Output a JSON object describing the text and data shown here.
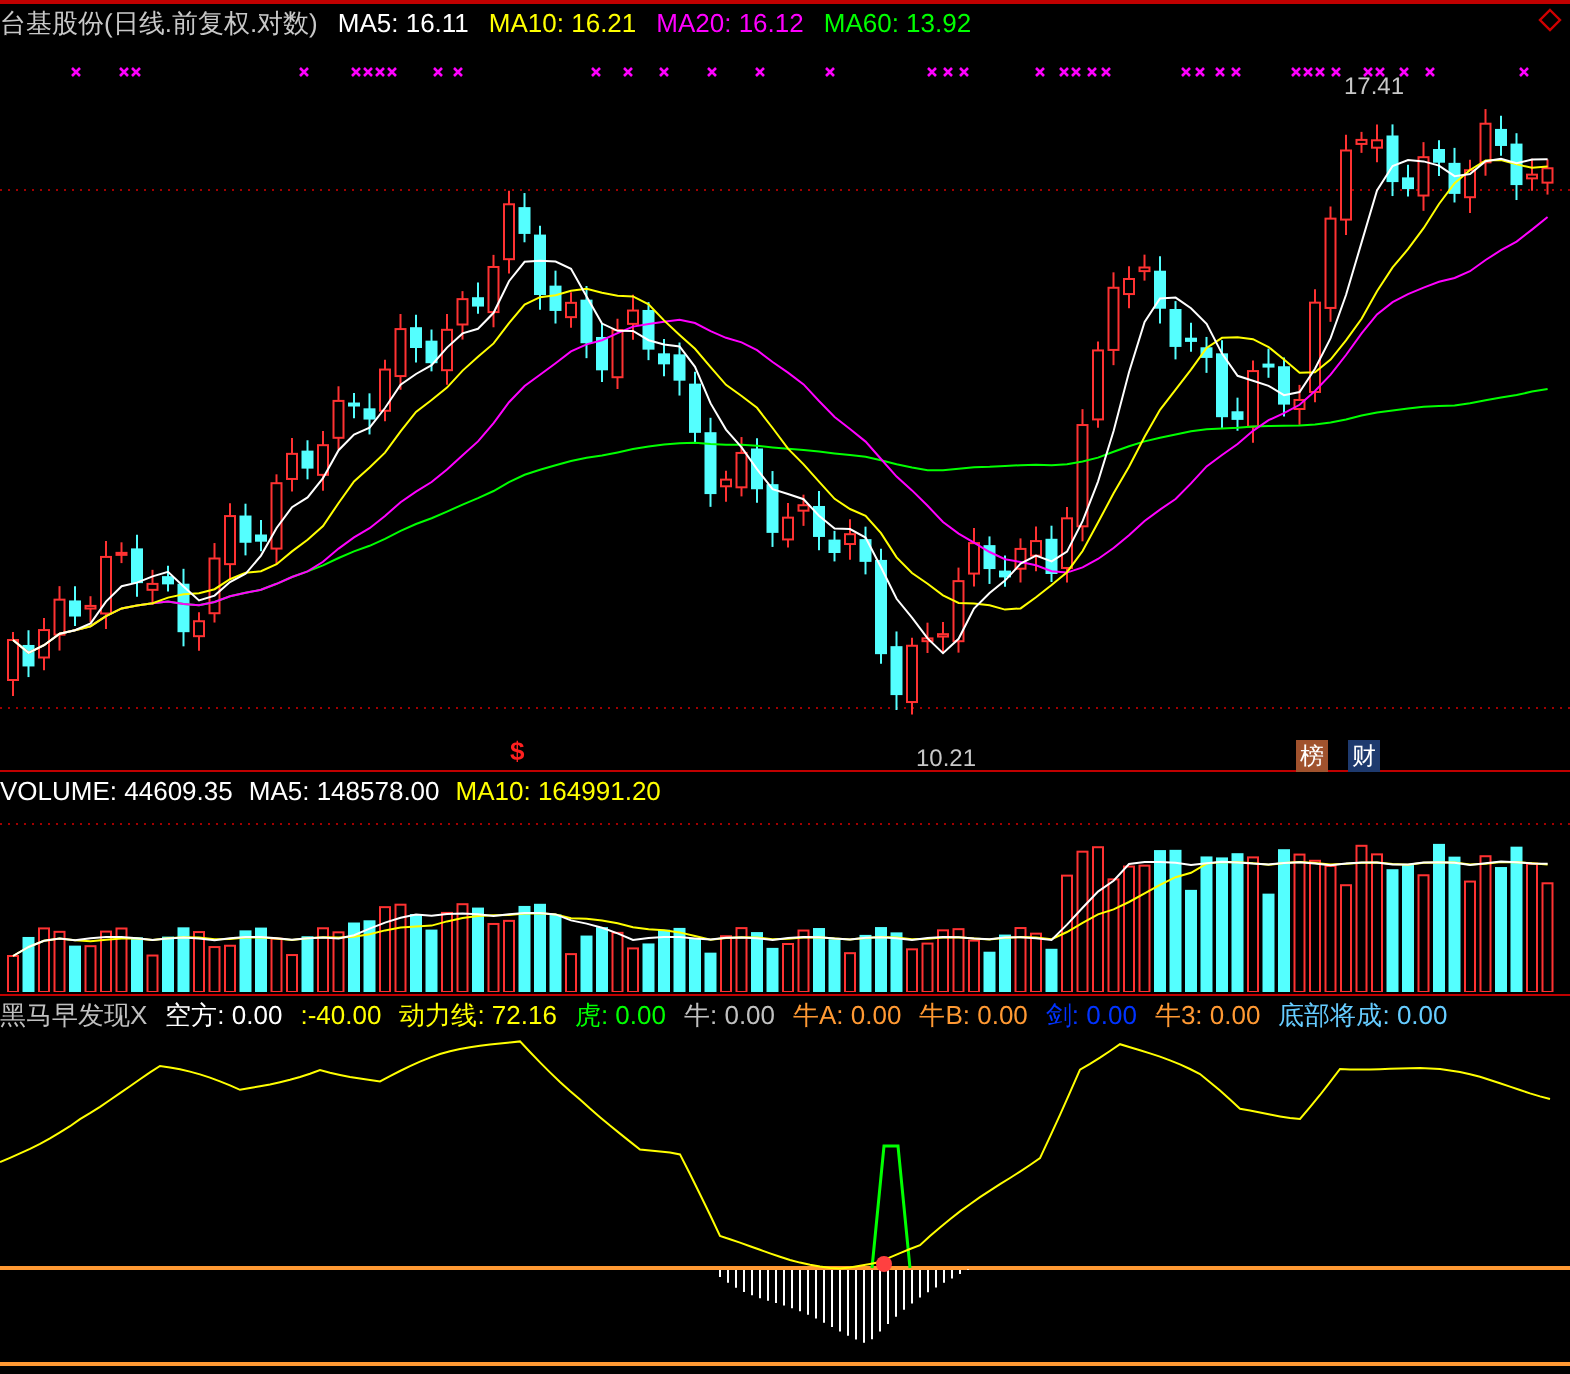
{
  "title": {
    "text": "台基股份(日线.前复权.对数)"
  },
  "main_legend": [
    {
      "label": "MA5: 16.11",
      "color": "#ffffff"
    },
    {
      "label": "MA10: 16.21",
      "color": "#ffff00"
    },
    {
      "label": "MA20: 16.12",
      "color": "#ff00ff"
    },
    {
      "label": "MA60: 13.92",
      "color": "#00ff00"
    }
  ],
  "price_labels": {
    "high": "17.41",
    "low": "10.21"
  },
  "marker": "$",
  "badges": [
    {
      "text": "榜",
      "color": "#a0522d"
    },
    {
      "text": "财",
      "color": "#1e3a6e"
    }
  ],
  "volume_legend": [
    {
      "label": "VOLUME: 44609.35",
      "color": "#ffffff"
    },
    {
      "label": "MA5: 148578.00",
      "color": "#ffffff"
    },
    {
      "label": "MA10: 164991.20",
      "color": "#ffff00"
    }
  ],
  "indicator_legend": [
    {
      "label": "黑马早发现X",
      "color": "#c0c0c0"
    },
    {
      "label": "空方: 0.00",
      "color": "#ffffff"
    },
    {
      "label": ":-40.00",
      "color": "#ffff00"
    },
    {
      "label": "动力线: 72.16",
      "color": "#ffff00"
    },
    {
      "label": "虎: 0.00",
      "color": "#00ff00"
    },
    {
      "label": "牛: 0.00",
      "color": "#c0c0c0"
    },
    {
      "label": "牛A: 0.00",
      "color": "#ff9933"
    },
    {
      "label": "牛B: 0.00",
      "color": "#ff9933"
    },
    {
      "label": "剑: 0.00",
      "color": "#0033ff"
    },
    {
      "label": "牛3: 0.00",
      "color": "#ff9933"
    },
    {
      "label": "底部将成: 0.00",
      "color": "#66ccff"
    }
  ]
}
